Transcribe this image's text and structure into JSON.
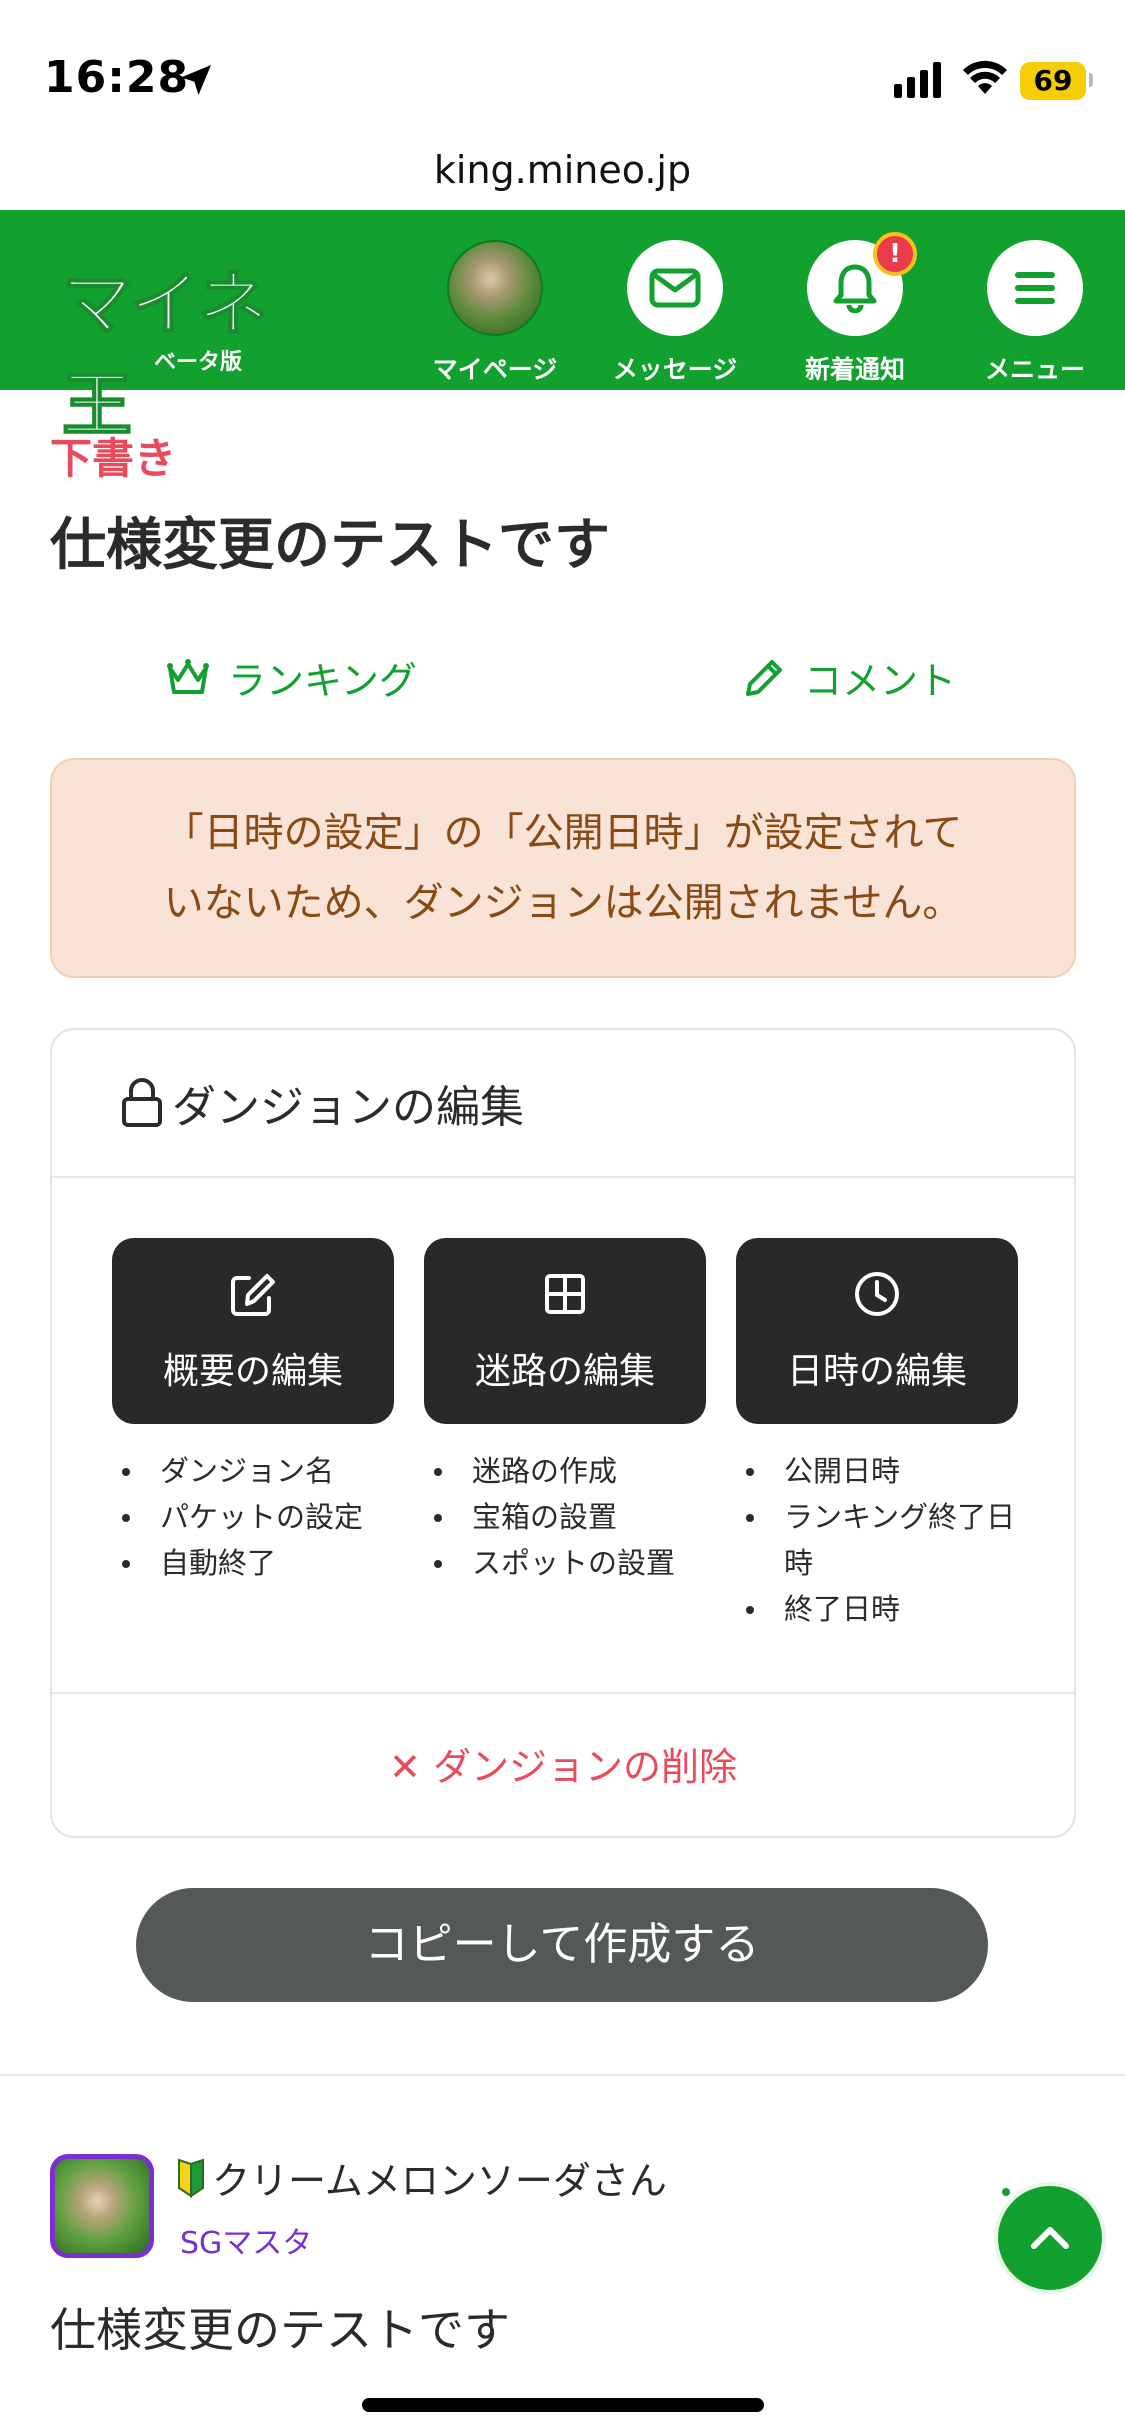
{
  "status_bar": {
    "time": "16:28",
    "battery": "69"
  },
  "browser": {
    "url": "king.mineo.jp"
  },
  "header": {
    "logo": "マイネ王",
    "logo_sub": "ベータ版",
    "nav": [
      {
        "label": "マイページ",
        "icon": "avatar"
      },
      {
        "label": "メッセージ",
        "icon": "envelope-icon"
      },
      {
        "label": "新着通知",
        "icon": "bell-icon",
        "badge": "!"
      },
      {
        "label": "メニュー",
        "icon": "hamburger-icon"
      }
    ],
    "accent_color": "#12a12e"
  },
  "main": {
    "draft_label": "下書き",
    "title": "仕様変更のテストです",
    "actions": {
      "ranking": "ランキング",
      "comment": "コメント"
    },
    "notice_line1": "「日時の設定」の「公開日時」が設定されて",
    "notice_line2": "いないため、ダンジョンは公開されません。",
    "edit_card": {
      "title": "ダンジョンの編集",
      "buttons": [
        {
          "label": "概要の編集",
          "icon": "edit-icon",
          "items": [
            "ダンジョン名",
            "パケットの設定",
            "自動終了"
          ]
        },
        {
          "label": "迷路の編集",
          "icon": "grid-icon",
          "items": [
            "迷路の作成",
            "宝箱の設置",
            "スポットの設置"
          ]
        },
        {
          "label": "日時の編集",
          "icon": "clock-icon",
          "items": [
            "公開日時",
            "ランキング終了日時",
            "終了日時"
          ]
        }
      ],
      "delete_label": "✕ ダンジョンの削除"
    },
    "copy_button": "コピーして作成する"
  },
  "post": {
    "author": "クリームメロンソーダさん",
    "rank": "SGマスタ",
    "text": "仕様変更のテストです"
  }
}
